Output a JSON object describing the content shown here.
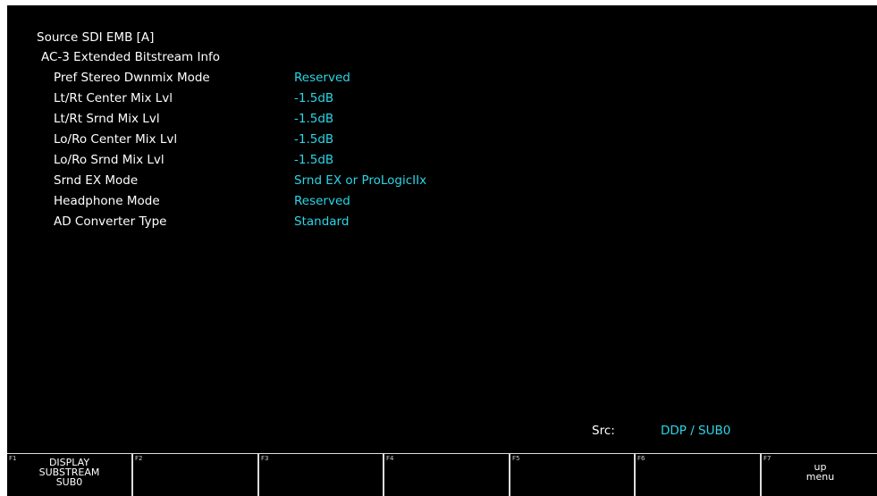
{
  "source_title": "Source SDI EMB [A]",
  "section_title": "AC-3 Extended Bitstream Info",
  "rows": [
    {
      "label": "Pref Stereo Dwnmix Mode",
      "value": "Reserved"
    },
    {
      "label": "Lt/Rt Center Mix Lvl",
      "value": "-1.5dB"
    },
    {
      "label": "Lt/Rt Srnd Mix Lvl",
      "value": "-1.5dB"
    },
    {
      "label": "Lo/Ro Center Mix Lvl",
      "value": "-1.5dB"
    },
    {
      "label": "Lo/Ro Srnd Mix Lvl",
      "value": "-1.5dB"
    },
    {
      "label": "Srnd EX Mode",
      "value": "Srnd EX or ProLogicIIx"
    },
    {
      "label": "Headphone Mode",
      "value": "Reserved"
    },
    {
      "label": "AD Converter Type",
      "value": "Standard"
    }
  ],
  "src": {
    "label": "Src:",
    "value": "DDP / SUB0"
  },
  "fkeys": [
    {
      "num": "F1",
      "lines": [
        "DISPLAY",
        "SUBSTREAM",
        "SUB0"
      ]
    },
    {
      "num": "F2",
      "lines": []
    },
    {
      "num": "F3",
      "lines": []
    },
    {
      "num": "F4",
      "lines": []
    },
    {
      "num": "F5",
      "lines": []
    },
    {
      "num": "F6",
      "lines": []
    },
    {
      "num": "F7",
      "lines": [
        "up",
        "menu"
      ]
    }
  ],
  "colors": {
    "value_text": "#2ad6e6",
    "label_text": "#ffffff",
    "background": "#000000"
  }
}
